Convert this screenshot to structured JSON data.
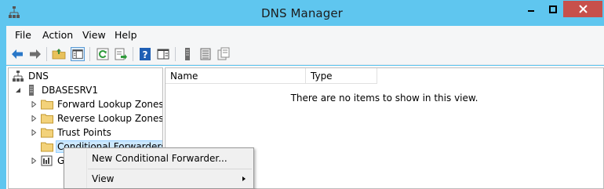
{
  "window": {
    "title": "DNS Manager"
  },
  "menu": {
    "file": "File",
    "action": "Action",
    "view": "View",
    "help": "Help"
  },
  "toolbar": {
    "icons": [
      "back-arrow-icon",
      "forward-arrow-icon",
      "up-folder-icon",
      "show-hide-tree-icon",
      "refresh-icon",
      "export-list-icon",
      "help-icon",
      "properties-icon",
      "server-icon",
      "list-icon",
      "copy-icon"
    ]
  },
  "tree": {
    "root": "DNS",
    "server": "DBASESRV1",
    "items": [
      "Forward Lookup Zones",
      "Reverse Lookup Zones",
      "Trust Points",
      "Conditional Forwarders",
      "G"
    ]
  },
  "list": {
    "columns": [
      "Name",
      "Type"
    ],
    "empty_message": "There are no items to show in this view."
  },
  "context_menu": {
    "items": [
      "New Conditional Forwarder...",
      "View"
    ]
  },
  "colors": {
    "titlebar": "#5fc6ef",
    "close_button": "#c7504b",
    "selection": "#cce8ff"
  }
}
